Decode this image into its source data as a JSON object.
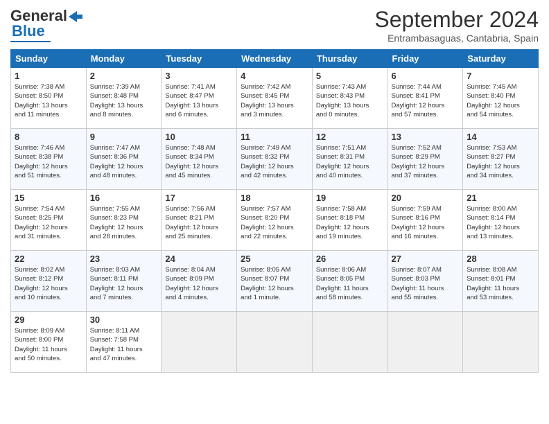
{
  "logo": {
    "text1": "General",
    "text2": "Blue"
  },
  "title": "September 2024",
  "location": "Entrambasaguas, Cantabria, Spain",
  "headers": [
    "Sunday",
    "Monday",
    "Tuesday",
    "Wednesday",
    "Thursday",
    "Friday",
    "Saturday"
  ],
  "weeks": [
    [
      {
        "day": "1",
        "lines": [
          "Sunrise: 7:38 AM",
          "Sunset: 8:50 PM",
          "Daylight: 13 hours",
          "and 11 minutes."
        ]
      },
      {
        "day": "2",
        "lines": [
          "Sunrise: 7:39 AM",
          "Sunset: 8:48 PM",
          "Daylight: 13 hours",
          "and 8 minutes."
        ]
      },
      {
        "day": "3",
        "lines": [
          "Sunrise: 7:41 AM",
          "Sunset: 8:47 PM",
          "Daylight: 13 hours",
          "and 6 minutes."
        ]
      },
      {
        "day": "4",
        "lines": [
          "Sunrise: 7:42 AM",
          "Sunset: 8:45 PM",
          "Daylight: 13 hours",
          "and 3 minutes."
        ]
      },
      {
        "day": "5",
        "lines": [
          "Sunrise: 7:43 AM",
          "Sunset: 8:43 PM",
          "Daylight: 13 hours",
          "and 0 minutes."
        ]
      },
      {
        "day": "6",
        "lines": [
          "Sunrise: 7:44 AM",
          "Sunset: 8:41 PM",
          "Daylight: 12 hours",
          "and 57 minutes."
        ]
      },
      {
        "day": "7",
        "lines": [
          "Sunrise: 7:45 AM",
          "Sunset: 8:40 PM",
          "Daylight: 12 hours",
          "and 54 minutes."
        ]
      }
    ],
    [
      {
        "day": "8",
        "lines": [
          "Sunrise: 7:46 AM",
          "Sunset: 8:38 PM",
          "Daylight: 12 hours",
          "and 51 minutes."
        ]
      },
      {
        "day": "9",
        "lines": [
          "Sunrise: 7:47 AM",
          "Sunset: 8:36 PM",
          "Daylight: 12 hours",
          "and 48 minutes."
        ]
      },
      {
        "day": "10",
        "lines": [
          "Sunrise: 7:48 AM",
          "Sunset: 8:34 PM",
          "Daylight: 12 hours",
          "and 45 minutes."
        ]
      },
      {
        "day": "11",
        "lines": [
          "Sunrise: 7:49 AM",
          "Sunset: 8:32 PM",
          "Daylight: 12 hours",
          "and 42 minutes."
        ]
      },
      {
        "day": "12",
        "lines": [
          "Sunrise: 7:51 AM",
          "Sunset: 8:31 PM",
          "Daylight: 12 hours",
          "and 40 minutes."
        ]
      },
      {
        "day": "13",
        "lines": [
          "Sunrise: 7:52 AM",
          "Sunset: 8:29 PM",
          "Daylight: 12 hours",
          "and 37 minutes."
        ]
      },
      {
        "day": "14",
        "lines": [
          "Sunrise: 7:53 AM",
          "Sunset: 8:27 PM",
          "Daylight: 12 hours",
          "and 34 minutes."
        ]
      }
    ],
    [
      {
        "day": "15",
        "lines": [
          "Sunrise: 7:54 AM",
          "Sunset: 8:25 PM",
          "Daylight: 12 hours",
          "and 31 minutes."
        ]
      },
      {
        "day": "16",
        "lines": [
          "Sunrise: 7:55 AM",
          "Sunset: 8:23 PM",
          "Daylight: 12 hours",
          "and 28 minutes."
        ]
      },
      {
        "day": "17",
        "lines": [
          "Sunrise: 7:56 AM",
          "Sunset: 8:21 PM",
          "Daylight: 12 hours",
          "and 25 minutes."
        ]
      },
      {
        "day": "18",
        "lines": [
          "Sunrise: 7:57 AM",
          "Sunset: 8:20 PM",
          "Daylight: 12 hours",
          "and 22 minutes."
        ]
      },
      {
        "day": "19",
        "lines": [
          "Sunrise: 7:58 AM",
          "Sunset: 8:18 PM",
          "Daylight: 12 hours",
          "and 19 minutes."
        ]
      },
      {
        "day": "20",
        "lines": [
          "Sunrise: 7:59 AM",
          "Sunset: 8:16 PM",
          "Daylight: 12 hours",
          "and 16 minutes."
        ]
      },
      {
        "day": "21",
        "lines": [
          "Sunrise: 8:00 AM",
          "Sunset: 8:14 PM",
          "Daylight: 12 hours",
          "and 13 minutes."
        ]
      }
    ],
    [
      {
        "day": "22",
        "lines": [
          "Sunrise: 8:02 AM",
          "Sunset: 8:12 PM",
          "Daylight: 12 hours",
          "and 10 minutes."
        ]
      },
      {
        "day": "23",
        "lines": [
          "Sunrise: 8:03 AM",
          "Sunset: 8:11 PM",
          "Daylight: 12 hours",
          "and 7 minutes."
        ]
      },
      {
        "day": "24",
        "lines": [
          "Sunrise: 8:04 AM",
          "Sunset: 8:09 PM",
          "Daylight: 12 hours",
          "and 4 minutes."
        ]
      },
      {
        "day": "25",
        "lines": [
          "Sunrise: 8:05 AM",
          "Sunset: 8:07 PM",
          "Daylight: 12 hours",
          "and 1 minute."
        ]
      },
      {
        "day": "26",
        "lines": [
          "Sunrise: 8:06 AM",
          "Sunset: 8:05 PM",
          "Daylight: 11 hours",
          "and 58 minutes."
        ]
      },
      {
        "day": "27",
        "lines": [
          "Sunrise: 8:07 AM",
          "Sunset: 8:03 PM",
          "Daylight: 11 hours",
          "and 55 minutes."
        ]
      },
      {
        "day": "28",
        "lines": [
          "Sunrise: 8:08 AM",
          "Sunset: 8:01 PM",
          "Daylight: 11 hours",
          "and 53 minutes."
        ]
      }
    ],
    [
      {
        "day": "29",
        "lines": [
          "Sunrise: 8:09 AM",
          "Sunset: 8:00 PM",
          "Daylight: 11 hours",
          "and 50 minutes."
        ]
      },
      {
        "day": "30",
        "lines": [
          "Sunrise: 8:11 AM",
          "Sunset: 7:58 PM",
          "Daylight: 11 hours",
          "and 47 minutes."
        ]
      },
      null,
      null,
      null,
      null,
      null
    ]
  ]
}
